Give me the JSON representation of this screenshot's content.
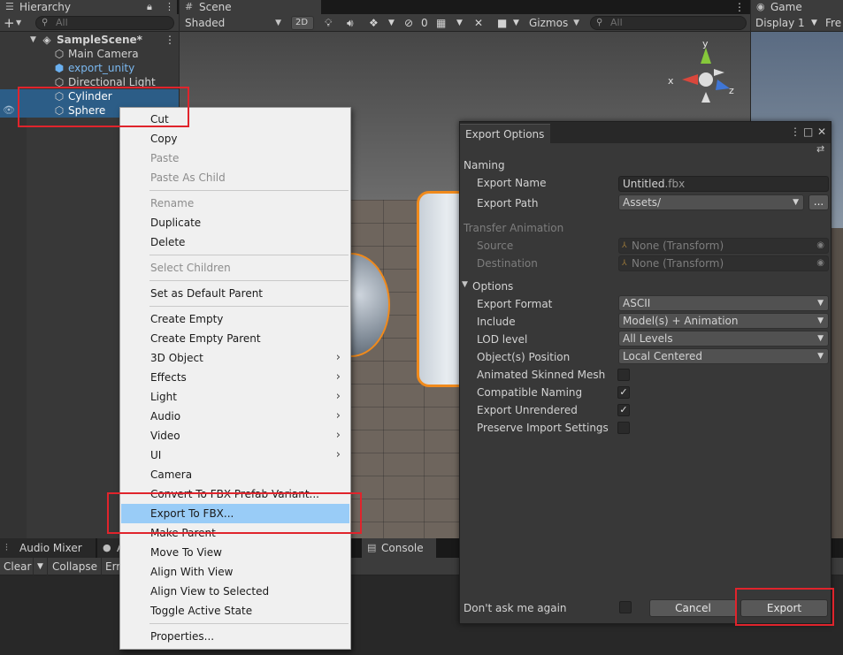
{
  "hierarchy": {
    "tab_label": "Hierarchy",
    "search_placeholder": "All",
    "scene_name": "SampleScene*",
    "items": [
      {
        "label": "Main Camera"
      },
      {
        "label": "export_unity"
      },
      {
        "label": "Directional Light"
      },
      {
        "label": "Cylinder"
      },
      {
        "label": "Sphere"
      }
    ]
  },
  "scene": {
    "tab_label": "Scene",
    "shading_mode": "Shaded",
    "mode_2d": "2D",
    "hidden_count": "0",
    "gizmos_label": "Gizmos",
    "search_placeholder": "All",
    "axis_x": "x",
    "axis_y": "y",
    "axis_z": "z"
  },
  "game": {
    "tab_label": "Game",
    "display": "Display 1",
    "aspect": "Fre"
  },
  "bottom": {
    "audio_mixer_tab": "Audio Mixer",
    "animation_tab_partial": "A",
    "console_tab": "Console",
    "clear": "Clear",
    "collapse": "Collapse",
    "error_partial": "Err"
  },
  "context_menu": {
    "cut": "Cut",
    "copy": "Copy",
    "paste": "Paste",
    "paste_as_child": "Paste As Child",
    "rename": "Rename",
    "duplicate": "Duplicate",
    "delete": "Delete",
    "select_children": "Select Children",
    "set_default_parent": "Set as Default Parent",
    "create_empty": "Create Empty",
    "create_empty_parent": "Create Empty Parent",
    "object_3d": "3D Object",
    "effects": "Effects",
    "light": "Light",
    "audio": "Audio",
    "video": "Video",
    "ui": "UI",
    "camera": "Camera",
    "convert_fbx_prefab": "Convert To FBX Prefab Variant...",
    "export_to_fbx": "Export To FBX...",
    "make_parent": "Make Parent",
    "move_to_view": "Move To View",
    "align_with_view": "Align With View",
    "align_view_selected": "Align View to Selected",
    "toggle_active": "Toggle Active State",
    "properties": "Properties..."
  },
  "export_dialog": {
    "title": "Export Options",
    "naming_header": "Naming",
    "export_name_label": "Export Name",
    "export_name_value": "Untitled",
    "export_name_ext": ".fbx",
    "export_path_label": "Export Path",
    "export_path_value": "Assets/",
    "browse_label": "...",
    "transfer_header": "Transfer Animation",
    "source_label": "Source",
    "source_value": "None (Transform)",
    "destination_label": "Destination",
    "destination_value": "None (Transform)",
    "options_header": "Options",
    "export_format_label": "Export Format",
    "export_format_value": "ASCII",
    "include_label": "Include",
    "include_value": "Model(s) + Animation",
    "lod_label": "LOD level",
    "lod_value": "All Levels",
    "position_label": "Object(s) Position",
    "position_value": "Local Centered",
    "animated_skinned_label": "Animated Skinned Mesh",
    "animated_skinned_checked": false,
    "compatible_naming_label": "Compatible Naming",
    "compatible_naming_checked": true,
    "export_unrendered_label": "Export Unrendered",
    "export_unrendered_checked": true,
    "preserve_import_label": "Preserve Import Settings",
    "preserve_import_checked": false,
    "dont_ask_label": "Don't ask me again",
    "cancel_label": "Cancel",
    "export_label": "Export"
  },
  "colors": {
    "selection_blue": "#2c5d87",
    "menu_highlight": "#99ccf7",
    "annotation_red": "#e0242c",
    "object_outline_orange": "#f08a1c"
  }
}
